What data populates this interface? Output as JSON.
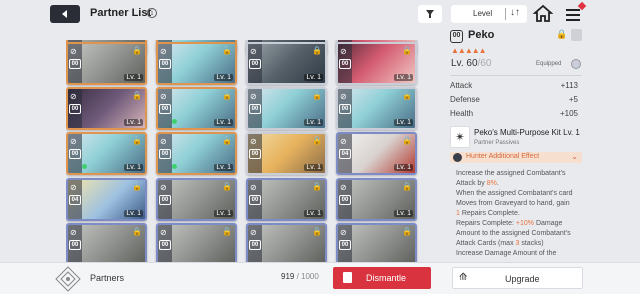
{
  "header": {
    "title": "Partner List",
    "info_icon": "i",
    "sort_label": "Level"
  },
  "grid": {
    "rows": [
      [
        {
          "art": "gray",
          "rarity": "orange",
          "cost": "00",
          "level": "",
          "gem": false
        },
        {
          "art": "bluehair",
          "rarity": "orange",
          "cost": "00",
          "level": "",
          "gem": false
        },
        {
          "art": "mech",
          "rarity": "gray",
          "cost": "00",
          "level": "",
          "gem": false
        },
        {
          "art": "pink",
          "rarity": "gray",
          "cost": "00",
          "level": "",
          "gem": false
        }
      ],
      [
        {
          "art": "gray",
          "rarity": "orange",
          "cost": "00",
          "level": "Lv. 1",
          "gem": false
        },
        {
          "art": "bluehair",
          "rarity": "orange",
          "cost": "00",
          "level": "Lv. 1",
          "gem": false
        },
        {
          "art": "mech",
          "rarity": "gray",
          "cost": "00",
          "level": "Lv. 1",
          "gem": false
        },
        {
          "art": "pink",
          "rarity": "gray",
          "cost": "00",
          "level": "Lv. 1",
          "gem": false
        }
      ],
      [
        {
          "art": "darkhair",
          "rarity": "orange",
          "cost": "00",
          "level": "Lv. 1",
          "gem": false
        },
        {
          "art": "bluehair",
          "rarity": "orange",
          "cost": "00",
          "level": "Lv. 1",
          "gem": true
        },
        {
          "art": "bluehair",
          "rarity": "gray",
          "cost": "00",
          "level": "Lv. 1",
          "gem": false
        },
        {
          "art": "bluehair",
          "rarity": "gray",
          "cost": "00",
          "level": "Lv. 1",
          "gem": false
        }
      ],
      [
        {
          "art": "bluehair",
          "rarity": "orange",
          "cost": "00",
          "level": "Lv. 1",
          "gem": true
        },
        {
          "art": "bluehair",
          "rarity": "orange",
          "cost": "00",
          "level": "Lv. 1",
          "gem": true
        },
        {
          "art": "blonde",
          "rarity": "gray",
          "cost": "00",
          "level": "Lv. 1",
          "gem": false
        },
        {
          "art": "redwhite",
          "rarity": "blue",
          "cost": "04",
          "level": "Lv. 1",
          "gem": false
        }
      ],
      [
        {
          "art": "blondeblue",
          "rarity": "blue",
          "cost": "04",
          "level": "Lv. 1",
          "gem": false
        },
        {
          "art": "gray",
          "rarity": "blue",
          "cost": "00",
          "level": "Lv. 1",
          "gem": false
        },
        {
          "art": "gray",
          "rarity": "blue",
          "cost": "00",
          "level": "Lv. 1",
          "gem": false
        },
        {
          "art": "gray",
          "rarity": "blue",
          "cost": "00",
          "level": "Lv. 1",
          "gem": false
        }
      ],
      [
        {
          "art": "gray",
          "rarity": "blue",
          "cost": "00",
          "level": "",
          "gem": false
        },
        {
          "art": "gray",
          "rarity": "blue",
          "cost": "00",
          "level": "",
          "gem": false
        },
        {
          "art": "gray",
          "rarity": "blue",
          "cost": "00",
          "level": "",
          "gem": false
        },
        {
          "art": "gray",
          "rarity": "blue",
          "cost": "00",
          "level": "",
          "gem": false
        }
      ]
    ]
  },
  "detail": {
    "cost": "00",
    "name": "Peko",
    "stars": "▲▲▲▲▲",
    "level_current": "Lv. 60",
    "level_max": "/60",
    "equipped_label": "Equipped",
    "stats": [
      {
        "label": "Attack",
        "value": "+113"
      },
      {
        "label": "Defense",
        "value": "+5"
      },
      {
        "label": "Health",
        "value": "+105"
      }
    ],
    "passive_title": "Peko's Multi-Purpose Kit Lv. 1",
    "passive_sub": "Partner Passives",
    "effect_label": "Hunter Additional Effect",
    "effect_lines": [
      {
        "t": "Increase the assigned Combatant's"
      },
      {
        "t": "Attack by ",
        "h": "8%",
        "e": "."
      },
      {
        "t": "When the assigned Combatant's card"
      },
      {
        "t": "Moves from Graveyard to hand, gain"
      },
      {
        "h": "1",
        "e": " Repairs Complete."
      },
      {
        "t": "Repairs Complete: ",
        "h": "+10%",
        "e": " Damage"
      },
      {
        "t": "Amount to the assigned Combatant's"
      },
      {
        "t": "Attack Cards (max ",
        "h": "3",
        "e": " stacks)"
      },
      {
        "t": "Increase Damage Amount of the"
      }
    ]
  },
  "footer": {
    "partners_label": "Partners",
    "count_current": "919",
    "count_sep": " / ",
    "count_max": "1000",
    "dismantle_label": "Dismantle",
    "upgrade_label": "Upgrade"
  },
  "colors": {
    "accent_orange": "#e8733a",
    "dismantle_red": "#d8333f"
  }
}
